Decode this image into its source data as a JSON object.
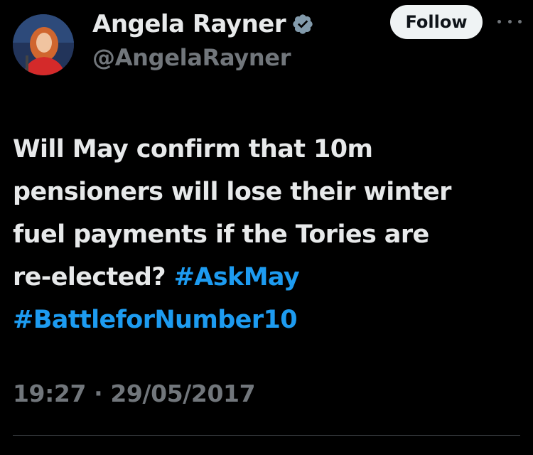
{
  "author": {
    "name": "Angela Rayner",
    "handle": "@AngelaRayner",
    "verified": true
  },
  "actions": {
    "follow_label": "Follow",
    "more_icon": "more-horizontal-icon"
  },
  "tweet": {
    "lines": [
      {
        "text": "Will May confirm that 10m"
      },
      {
        "text": "pensioners will lose their winter"
      },
      {
        "text": "fuel payments if the Tories are"
      },
      {
        "text": "re-elected?",
        "hashtag": "#AskMay"
      },
      {
        "hashtag": "#BattleforNumber10"
      }
    ]
  },
  "meta": {
    "time": "19:27",
    "separator": "·",
    "date": "29/05/2017"
  },
  "colors": {
    "background": "#000000",
    "text": "#e7e9ea",
    "secondary": "#71767b",
    "link": "#1d9bf0",
    "follow_bg": "#eff3f4",
    "verified_badge": "#829aab"
  }
}
